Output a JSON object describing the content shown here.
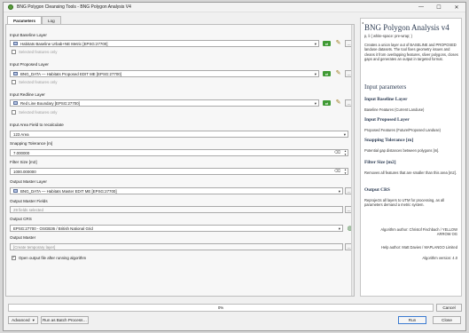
{
  "window": {
    "title": "BNG Polygon Cleansing Tools - BNG Polygon Analysis V4",
    "minimize": "—",
    "maximize": "☐",
    "close": "✕"
  },
  "tabs": [
    "Parameters",
    "Log"
  ],
  "params": {
    "baseline_label": "Input Baseline Layer",
    "baseline_value": "Habitats Baseline Urbab+NE Metric [EPSG:27700]",
    "baseline_selected": "Selected features only",
    "proposed_label": "Input Proposed Layer",
    "proposed_value": "BNG_DATA — Habitats Proposed EDIT ME [EPSG:27700]",
    "proposed_selected": "Selected features only",
    "redline_label": "Input Redline Layer",
    "redline_value": "Red Line Boundary [EPSG:27700]",
    "redline_selected": "Selected features only",
    "area_field_label": "Input Area Field to recalculate",
    "area_field_value": "123 Area",
    "snap_label": "Snapping Tolerance [m]",
    "snap_value": "7.000000",
    "filter_label": "Filter Size [m2]",
    "filter_value": "1000.000000",
    "master_layer_label": "Output Master Layer",
    "master_layer_value": "BNG_DATA — Habitats Master EDIT ME [EPSG:27700]",
    "master_fields_label": "Output Master Fields",
    "master_fields_value": "29 fields selected",
    "crs_label": "Output CRS",
    "crs_value": "EPSG:27700 - OSGB36 / British National Grid",
    "master_out_label": "Output Master",
    "master_out_placeholder": "[Create temporary layer]",
    "open_output": "Open output file after running algorithm",
    "dots": "…"
  },
  "help": {
    "collapse": "◂",
    "title": "BNG Polygon Analysis v4",
    "style_hint": "p, li { white-space: pre-wrap; }",
    "intro": "Creates a union layer out of BASELINE and PROPOSED landuse datasets. The tool fixes geometry issues and cleans it from overlapping features, sliver polygons, closes gaps and generates an output in targeted format.",
    "params_heading": "Input parameters",
    "baseline_heading": "Input Baseline Layer",
    "baseline_desc": "Baseline Features (Current Landuse)",
    "proposed_heading": "Input Proposed Layer",
    "proposed_desc": "Proposed Features (Future/Proposed Landuse)",
    "snap_heading": "Snapping Tolerance [m]",
    "snap_desc": "Potential gap distances between polygons [m].",
    "filter_heading": "Filter Size [m2]",
    "filter_desc": "Removes all features that are smaller than this area [m2].",
    "crs_heading": "Output CRS",
    "crs_desc": "Reprojects all layers to UTM for processing, as all parameters demand a metric system.",
    "author": "Algorithm author: Christof Fischbach / YELLOW ARROW OG",
    "help_author": "Help author: Matt Davies / MAPLANGO Limited",
    "version": "Algorithm version: 4.0"
  },
  "footer": {
    "progress": "0%",
    "progress_value": 0,
    "cancel": "Cancel",
    "advanced": "Advanced",
    "advanced_arrow": "▾",
    "batch": "Run as Batch Process…",
    "run": "Run",
    "close": "Close"
  }
}
